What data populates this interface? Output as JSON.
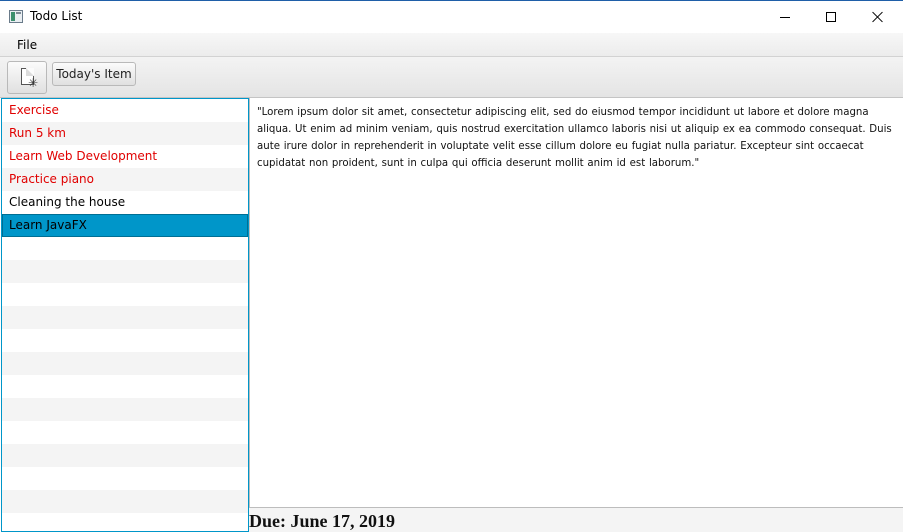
{
  "window": {
    "title": "Todo List",
    "icon": "app-window-icon"
  },
  "menu": {
    "items": [
      "File"
    ]
  },
  "toolbar": {
    "new_icon": "new-document-icon",
    "today_label": "Today's Item"
  },
  "todo_list": {
    "items": [
      {
        "label": "Exercise",
        "overdue": true,
        "selected": false
      },
      {
        "label": "Run 5 km",
        "overdue": true,
        "selected": false
      },
      {
        "label": "Learn Web Development",
        "overdue": true,
        "selected": false
      },
      {
        "label": "Practice piano",
        "overdue": true,
        "selected": false
      },
      {
        "label": "Cleaning the house",
        "overdue": false,
        "selected": false
      },
      {
        "label": "Learn JavaFX",
        "overdue": false,
        "selected": true
      }
    ],
    "overdue_color": "#e00000",
    "selection_color": "#0096c9"
  },
  "detail": {
    "description": "\"Lorem ipsum dolor sit amet, consectetur adipiscing elit, sed do eiusmod tempor incididunt ut labore et dolore magna aliqua. Ut enim ad minim veniam, quis nostrud exercitation ullamco laboris nisi ut aliquip ex ea commodo consequat. Duis aute irure dolor in reprehenderit in voluptate velit esse cillum dolore eu fugiat nulla pariatur. Excepteur sint occaecat cupidatat non proident, sunt in culpa qui officia deserunt mollit anim id est laborum.\"",
    "due": "Due: June 17, 2019"
  }
}
